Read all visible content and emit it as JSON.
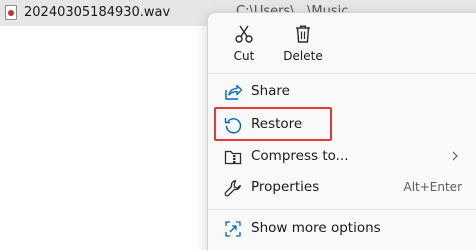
{
  "file": {
    "name": "20240305184930.wav",
    "path_fragment": "C:\\Users\\...\\Music"
  },
  "menu": {
    "quick_actions": [
      {
        "label": "Cut",
        "icon": "scissors-icon"
      },
      {
        "label": "Delete",
        "icon": "trash-icon"
      }
    ],
    "items": [
      {
        "label": "Share",
        "icon": "share-icon"
      },
      {
        "label": "Restore",
        "icon": "restore-icon",
        "highlighted": true
      },
      {
        "label": "Compress to...",
        "icon": "zip-folder-icon",
        "submenu": true
      },
      {
        "label": "Properties",
        "icon": "wrench-icon",
        "shortcut": "Alt+Enter"
      },
      {
        "label": "Show more options",
        "icon": "more-options-icon"
      }
    ]
  },
  "colors": {
    "accent": "#0067c0",
    "highlight_border": "#e53935",
    "file_row_bg": "#e6e6e6"
  }
}
